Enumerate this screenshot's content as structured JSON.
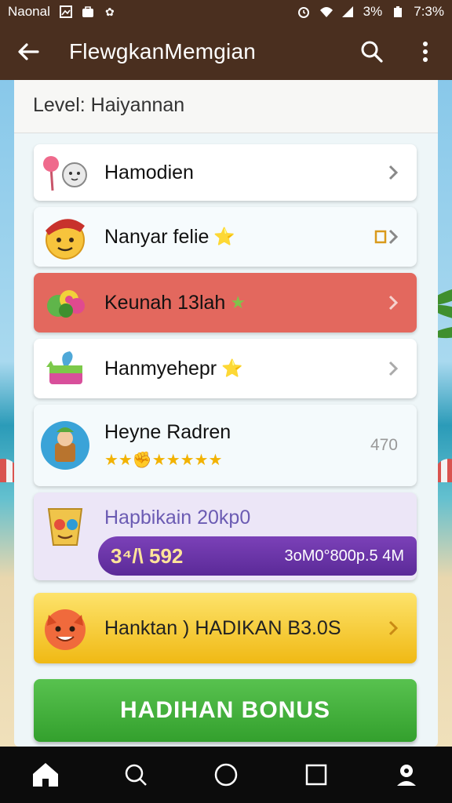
{
  "status_bar": {
    "carrier": "Naonal",
    "battery": "3%",
    "time": "7:3%",
    "icons": [
      "gallery-icon",
      "bag-icon",
      "gear-icon",
      "alarm-icon",
      "wifi-icon",
      "signal-icon",
      "battery-icon"
    ]
  },
  "app_bar": {
    "title": "FlewgkanMemgian",
    "icons": [
      "back-arrow-icon",
      "search-icon",
      "more-vert-icon"
    ]
  },
  "level_header": "Level: Haiyannan",
  "items": [
    {
      "label": "Hamodien",
      "icon": "lollipop-cat-icon"
    },
    {
      "label": "Nanyar felie",
      "icon": "chef-face-icon",
      "star": "⭐"
    },
    {
      "label": "Keunah 13lah",
      "icon": "candy-icon",
      "star": "★"
    },
    {
      "label": "Hanmyehepr",
      "icon": "gift-basket-icon",
      "star": "⭐"
    },
    {
      "label": "Heyne Radren",
      "icon": "basket-character-icon",
      "stars": "★★✊★★★★★",
      "value": "470"
    },
    {
      "label": "Hapbikain 20kp0",
      "icon": "masked-cup-icon",
      "progress": "3⁴/\\ 592",
      "bar_text": "3oM0°800p.5 4M"
    },
    {
      "label": "Hanktan ) HADIKAN  B3.0S",
      "icon": "fox-face-icon"
    }
  ],
  "bonus_button": "HADIHAN  BONUS",
  "nav_bar": {
    "icons": [
      "home-icon",
      "search-icon",
      "circle-icon",
      "square-icon",
      "profile-icon"
    ]
  },
  "colors": {
    "appbar": "#4a2f1f",
    "red_item": "#e3685e",
    "yellow_item": "#f4c22b",
    "purple_bar": "#6a34a8",
    "bonus": "#3fae38"
  }
}
